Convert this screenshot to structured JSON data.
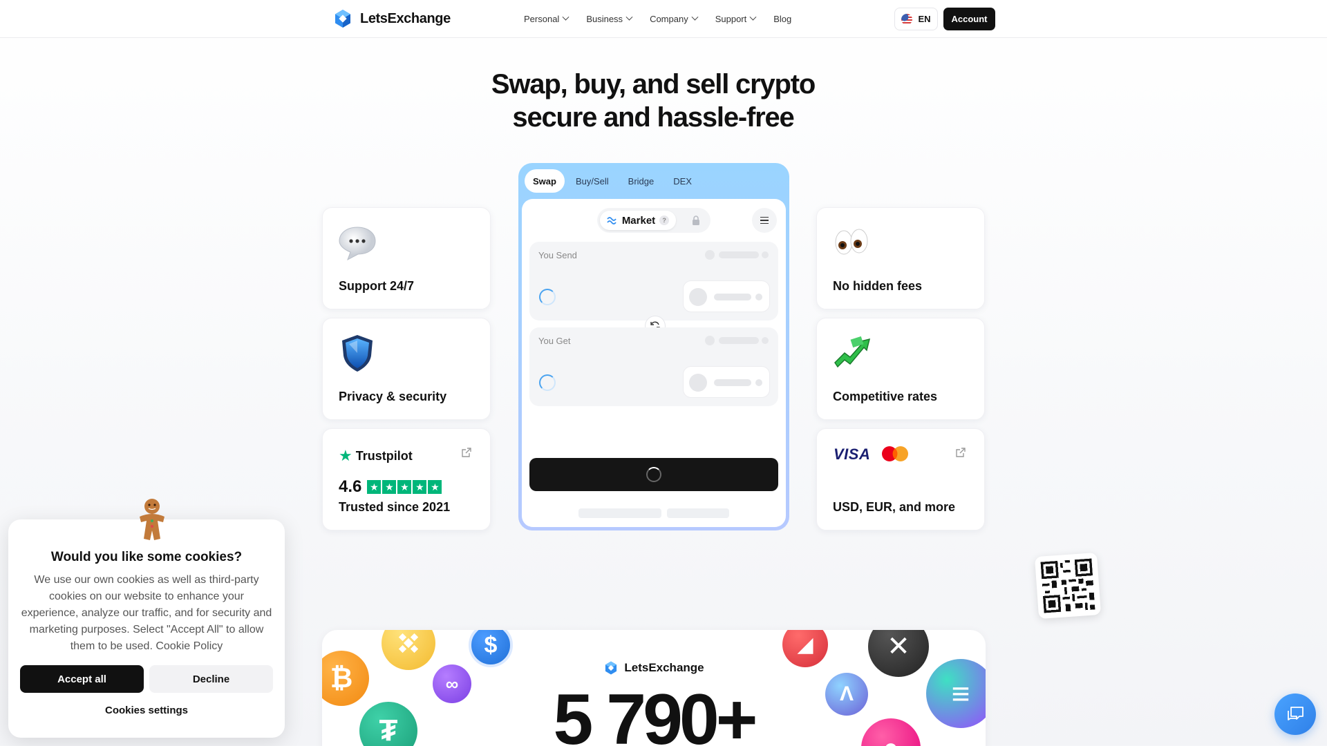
{
  "header": {
    "brand": "LetsExchange",
    "nav": [
      {
        "label": "Personal",
        "has_dropdown": true
      },
      {
        "label": "Business",
        "has_dropdown": true
      },
      {
        "label": "Company",
        "has_dropdown": true
      },
      {
        "label": "Support",
        "has_dropdown": true
      },
      {
        "label": "Blog",
        "has_dropdown": false
      }
    ],
    "language": "EN",
    "account_label": "Account"
  },
  "hero": {
    "line1": "Swap, buy, and sell crypto",
    "line2": "secure and hassle-free"
  },
  "features_left": [
    {
      "label": "Support 24/7",
      "icon": "speech-bubble-icon"
    },
    {
      "label": "Privacy & security",
      "icon": "shield-icon"
    }
  ],
  "features_right": [
    {
      "label": "No hidden fees",
      "icon": "eyes-icon"
    },
    {
      "label": "Competitive rates",
      "icon": "chart-up-icon"
    }
  ],
  "trustpilot": {
    "brand": "Trustpilot",
    "score": "4.6",
    "stars": 5,
    "label": "Trusted since 2021"
  },
  "payments": {
    "visa": "VISA",
    "label": "USD, EUR, and more"
  },
  "widget": {
    "tabs": [
      "Swap",
      "Buy/Sell",
      "Bridge",
      "DEX"
    ],
    "active_tab": "Swap",
    "mode": "Market",
    "mode_help": "?",
    "send_label": "You Send",
    "get_label": "You Get"
  },
  "coins_section": {
    "brand": "LetsExchange",
    "count": "5 790+"
  },
  "cookie_banner": {
    "title": "Would you like some cookies?",
    "text": "We use our own cookies as well as third-party cookies on our website to enhance your experience, analyze our traffic, and for security and marketing purposes. Select \"Accept All\" to allow them to be used.",
    "policy_link": "Cookie Policy",
    "accept": "Accept all",
    "decline": "Decline",
    "settings": "Cookies settings"
  },
  "colors": {
    "primary_dark": "#111111",
    "accent_blue": "#4aa3f0",
    "trustpilot_green": "#00b67a",
    "visa_blue": "#1a1f71"
  }
}
